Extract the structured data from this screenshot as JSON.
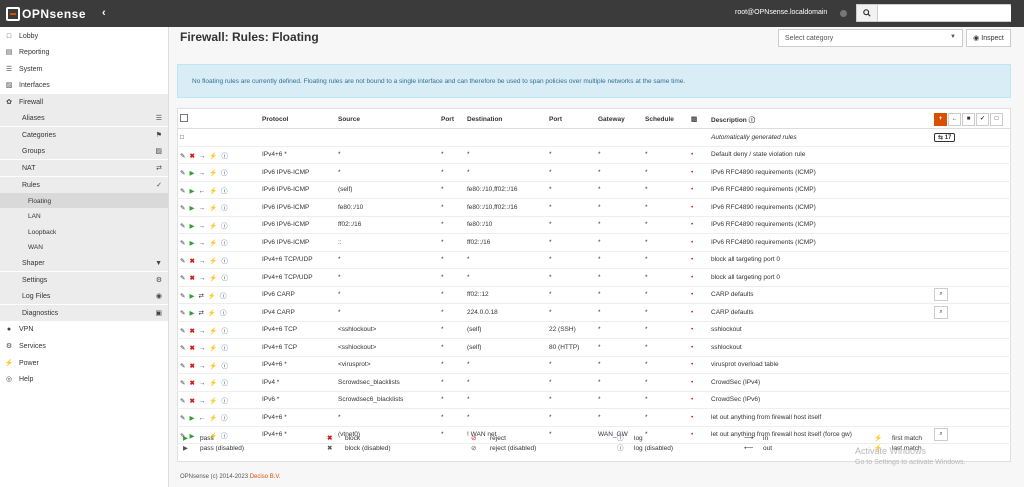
{
  "header": {
    "logo": "OPNsense",
    "user": "root@OPNsense.localdomain",
    "search_placeholder": ""
  },
  "sidebar": {
    "items": [
      {
        "label": "Lobby",
        "icon": "laptop-icon",
        "level": "top"
      },
      {
        "label": "Reporting",
        "icon": "chart-icon",
        "level": "top"
      },
      {
        "label": "System",
        "icon": "server-icon",
        "level": "top"
      },
      {
        "label": "Interfaces",
        "icon": "sitemap-icon",
        "level": "top"
      },
      {
        "label": "Firewall",
        "icon": "fire-icon",
        "level": "top"
      },
      {
        "label": "Aliases",
        "icon": "list-icon",
        "level": "sub"
      },
      {
        "label": "Categories",
        "icon": "tag-icon",
        "level": "sub"
      },
      {
        "label": "Groups",
        "icon": "sitemap-icon",
        "level": "sub"
      },
      {
        "label": "NAT",
        "icon": "exchange-icon",
        "level": "sub"
      },
      {
        "label": "Rules",
        "icon": "check-icon",
        "level": "sub"
      },
      {
        "label": "Floating",
        "icon": "",
        "level": "subsub"
      },
      {
        "label": "LAN",
        "icon": "",
        "level": "subsub"
      },
      {
        "label": "Loopback",
        "icon": "",
        "level": "subsub"
      },
      {
        "label": "WAN",
        "icon": "",
        "level": "subsub"
      },
      {
        "label": "Shaper",
        "icon": "filter-icon",
        "level": "sub"
      },
      {
        "label": "Settings",
        "icon": "cogs-icon",
        "level": "sub"
      },
      {
        "label": "Log Files",
        "icon": "eye-icon",
        "level": "sub"
      },
      {
        "label": "Diagnostics",
        "icon": "medkit-icon",
        "level": "sub"
      },
      {
        "label": "VPN",
        "icon": "globe-icon",
        "level": "top"
      },
      {
        "label": "Services",
        "icon": "cog-icon",
        "level": "top"
      },
      {
        "label": "Power",
        "icon": "plug-icon",
        "level": "top"
      },
      {
        "label": "Help",
        "icon": "lifebuoy-icon",
        "level": "top"
      }
    ]
  },
  "page": {
    "title": "Firewall: Rules: Floating",
    "category_placeholder": "Select category",
    "inspect_label": "Inspect",
    "info": "No floating rules are currently defined. Floating rules are not bound to a single interface and can therefore be used to span policies over multiple networks at the same time."
  },
  "table": {
    "headers": {
      "protocol": "Protocol",
      "source": "Source",
      "port": "Port",
      "destination": "Destination",
      "dport": "Port",
      "gateway": "Gateway",
      "schedule": "Schedule",
      "description": "Description"
    },
    "autogen_label": "Automatically generated rules",
    "autogen_count": "17",
    "rows": [
      {
        "action": "block",
        "dir": "in",
        "log": true,
        "protocol": "IPv4+6 *",
        "source": "*",
        "port": "*",
        "destination": "*",
        "dport": "*",
        "gateway": "*",
        "schedule": "*",
        "description": "Default deny / state violation rule",
        "inspect": false
      },
      {
        "action": "pass",
        "dir": "in",
        "log": true,
        "protocol": "IPv6 IPV6-ICMP",
        "source": "*",
        "port": "*",
        "destination": "*",
        "dport": "*",
        "gateway": "*",
        "schedule": "*",
        "description": "IPv6 RFC4890 requirements (ICMP)",
        "inspect": false
      },
      {
        "action": "pass",
        "dir": "out",
        "log": true,
        "protocol": "IPv6 IPV6-ICMP",
        "source": "(self)",
        "port": "*",
        "destination": "fe80::/10,ff02::/16",
        "dport": "*",
        "gateway": "*",
        "schedule": "*",
        "description": "IPv6 RFC4890 requirements (ICMP)",
        "inspect": false
      },
      {
        "action": "pass",
        "dir": "in",
        "log": true,
        "protocol": "IPv6 IPV6-ICMP",
        "source": "fe80::/10",
        "port": "*",
        "destination": "fe80::/10,ff02::/16",
        "dport": "*",
        "gateway": "*",
        "schedule": "*",
        "description": "IPv6 RFC4890 requirements (ICMP)",
        "inspect": false
      },
      {
        "action": "pass",
        "dir": "in",
        "log": true,
        "protocol": "IPv6 IPV6-ICMP",
        "source": "ff02::/16",
        "port": "*",
        "destination": "fe80::/10",
        "dport": "*",
        "gateway": "*",
        "schedule": "*",
        "description": "IPv6 RFC4890 requirements (ICMP)",
        "inspect": false
      },
      {
        "action": "pass",
        "dir": "in",
        "log": true,
        "protocol": "IPv6 IPV6-ICMP",
        "source": "::",
        "port": "*",
        "destination": "ff02::/16",
        "dport": "*",
        "gateway": "*",
        "schedule": "*",
        "description": "IPv6 RFC4890 requirements (ICMP)",
        "inspect": false
      },
      {
        "action": "block",
        "dir": "in",
        "log": true,
        "protocol": "IPv4+6 TCP/UDP",
        "source": "*",
        "port": "*",
        "destination": "*",
        "dport": "*",
        "gateway": "*",
        "schedule": "*",
        "description": "block all targeting port 0",
        "inspect": false
      },
      {
        "action": "block",
        "dir": "in",
        "log": true,
        "protocol": "IPv4+6 TCP/UDP",
        "source": "*",
        "port": "*",
        "destination": "*",
        "dport": "*",
        "gateway": "*",
        "schedule": "*",
        "description": "block all targeting port 0",
        "inspect": false
      },
      {
        "action": "pass",
        "dir": "both",
        "log": true,
        "protocol": "IPv6 CARP",
        "source": "*",
        "port": "*",
        "destination": "ff02::12",
        "dport": "*",
        "gateway": "*",
        "schedule": "*",
        "description": "CARP defaults",
        "inspect": true
      },
      {
        "action": "pass",
        "dir": "both",
        "log": true,
        "protocol": "IPv4 CARP",
        "source": "*",
        "port": "*",
        "destination": "224.0.0.18",
        "dport": "*",
        "gateway": "*",
        "schedule": "*",
        "description": "CARP defaults",
        "inspect": true
      },
      {
        "action": "block",
        "dir": "in",
        "log": true,
        "protocol": "IPv4+6 TCP",
        "source": "<sshlockout>",
        "port": "*",
        "destination": "(self)",
        "dport": "22 (SSH)",
        "gateway": "*",
        "schedule": "*",
        "description": "sshlockout",
        "inspect": false
      },
      {
        "action": "block",
        "dir": "in",
        "log": true,
        "protocol": "IPv4+6 TCP",
        "source": "<sshlockout>",
        "port": "*",
        "destination": "(self)",
        "dport": "80 (HTTP)",
        "gateway": "*",
        "schedule": "*",
        "description": "sshlockout",
        "inspect": false
      },
      {
        "action": "block",
        "dir": "in",
        "log": true,
        "protocol": "IPv4+6 *",
        "source": "<virusprot>",
        "port": "*",
        "destination": "*",
        "dport": "*",
        "gateway": "*",
        "schedule": "*",
        "description": "virusprot overload table",
        "inspect": false
      },
      {
        "action": "block",
        "dir": "in",
        "log": true,
        "protocol": "IPv4 *",
        "source": "Scrowdsec_blacklists",
        "port": "*",
        "destination": "*",
        "dport": "*",
        "gateway": "*",
        "schedule": "*",
        "description": "CrowdSec (IPv4)",
        "inspect": false
      },
      {
        "action": "block",
        "dir": "in",
        "log": true,
        "protocol": "IPv6 *",
        "source": "Scrowdsec6_blacklists",
        "port": "*",
        "destination": "*",
        "dport": "*",
        "gateway": "*",
        "schedule": "*",
        "description": "CrowdSec (IPv6)",
        "inspect": false
      },
      {
        "action": "pass",
        "dir": "out",
        "log": true,
        "protocol": "IPv4+6 *",
        "source": "*",
        "port": "*",
        "destination": "*",
        "dport": "*",
        "gateway": "*",
        "schedule": "*",
        "description": "let out anything from firewall host itself",
        "inspect": false
      },
      {
        "action": "pass",
        "dir": "out",
        "log": true,
        "protocol": "IPv4+6 *",
        "source": "(vtnet0)",
        "port": "*",
        "destination": "! WAN net",
        "dport": "*",
        "gateway": "WAN_GW",
        "schedule": "*",
        "description": "let out anything from firewall host itself (force gw)",
        "inspect": true
      }
    ]
  },
  "legend": {
    "pass": "pass",
    "pass_disabled": "pass (disabled)",
    "block": "block",
    "block_disabled": "block (disabled)",
    "reject": "reject",
    "reject_disabled": "reject (disabled)",
    "log": "log",
    "log_disabled": "log (disabled)",
    "in": "in",
    "out": "out",
    "first": "first match",
    "last": "last match"
  },
  "footer": {
    "prefix": "OPNsense (c) 2014-2023",
    "company": "Deciso B.V."
  },
  "watermark": {
    "title": "Activate Windows",
    "sub": "Go to Settings to activate Windows."
  }
}
